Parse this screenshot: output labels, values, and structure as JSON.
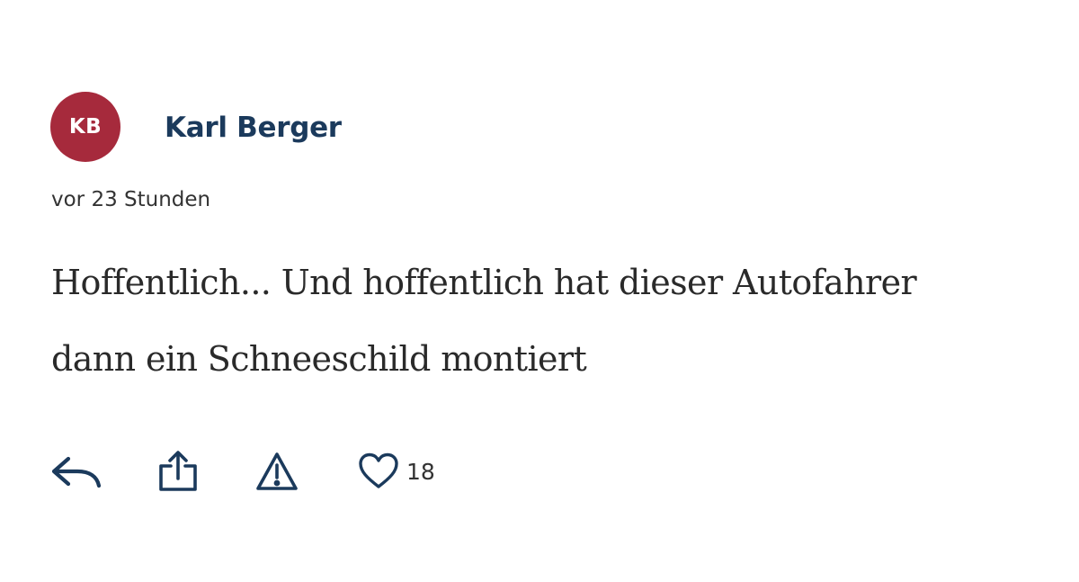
{
  "comment": {
    "author_initials": "KB",
    "author_name": "Karl Berger",
    "timestamp": "vor 23 Stunden",
    "body_line1": "Hoffentlich... Und hoffentlich hat dieser Autofahrer",
    "body_line2": "dann ein Schneeschild montiert",
    "avatar_color": "#a62a3c",
    "author_color": "#1b3a5c"
  },
  "actions": {
    "reply_icon": "reply-arrow-icon",
    "share_icon": "share-upload-icon",
    "report_icon": "warning-triangle-icon",
    "like_icon": "heart-outline-icon",
    "like_count": "18"
  }
}
